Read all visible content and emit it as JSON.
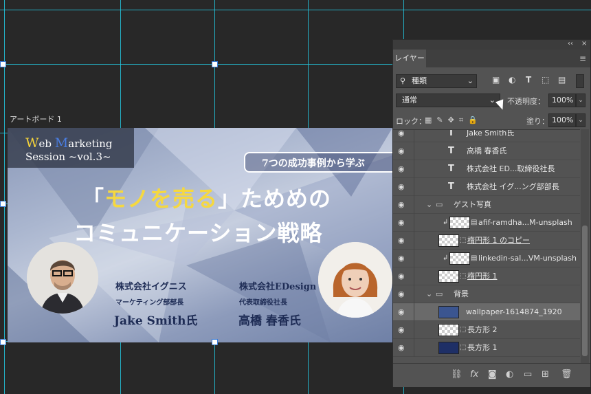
{
  "canvas": {
    "artboard_label": "アートボード 1"
  },
  "banner": {
    "series_line1_first": "W",
    "series_line1_rest": "eb ",
    "series_line1_m": "M",
    "series_line1_rest2": "arketing",
    "series_line2": "Session ~vol.3~",
    "case_button": "7つの成功事例から学ぶ",
    "headline1_open": "「",
    "headline1_yellow": "モノを売る",
    "headline1_rest": "」ためめの",
    "headline2": "コミュニケーション戦略",
    "speaker1": {
      "company": "株式会社イグニス",
      "role": "マーケティング部部長",
      "name": "Jake Smith氏"
    },
    "speaker2": {
      "company": "株式会社EDesign",
      "role": "代表取締役社長",
      "name": "高橋 春香氏"
    }
  },
  "panel": {
    "top_icons": {
      "collapse": "‹‹",
      "close": "×"
    },
    "tab_label": "レイヤー",
    "filter_label": "種類",
    "blend_mode": "通常",
    "opacity_label": "不透明度：",
    "opacity_value": "100%",
    "lock_label": "ロック：",
    "fill_label": "塗り：",
    "fill_value": "100%",
    "layers": [
      {
        "name": "Jake Smith氏",
        "kind": "text"
      },
      {
        "name": "高橋 春香氏",
        "kind": "text"
      },
      {
        "name": "株式会社 ED...取締役社長",
        "kind": "text"
      },
      {
        "name": "株式会社 イグ...ング部部長",
        "kind": "text"
      },
      {
        "name": "ゲスト写真",
        "kind": "group"
      },
      {
        "name": "afif-ramdha...M-unsplash",
        "kind": "linked"
      },
      {
        "name": "楕円形 1 のコピー",
        "kind": "shape"
      },
      {
        "name": "linkedin-sal...VM-unsplash",
        "kind": "linked"
      },
      {
        "name": "楕円形 1",
        "kind": "shape"
      },
      {
        "name": "背景",
        "kind": "group"
      },
      {
        "name": "wallpaper-1614874_1920",
        "kind": "image"
      },
      {
        "name": "長方形 2",
        "kind": "shape"
      },
      {
        "name": "長方形 1",
        "kind": "shape"
      }
    ]
  },
  "colors": {
    "guide": "#23c8e0",
    "accent_yellow": "#f5d840",
    "accent_blue": "#4a7de0",
    "panel_bg": "#535353"
  }
}
